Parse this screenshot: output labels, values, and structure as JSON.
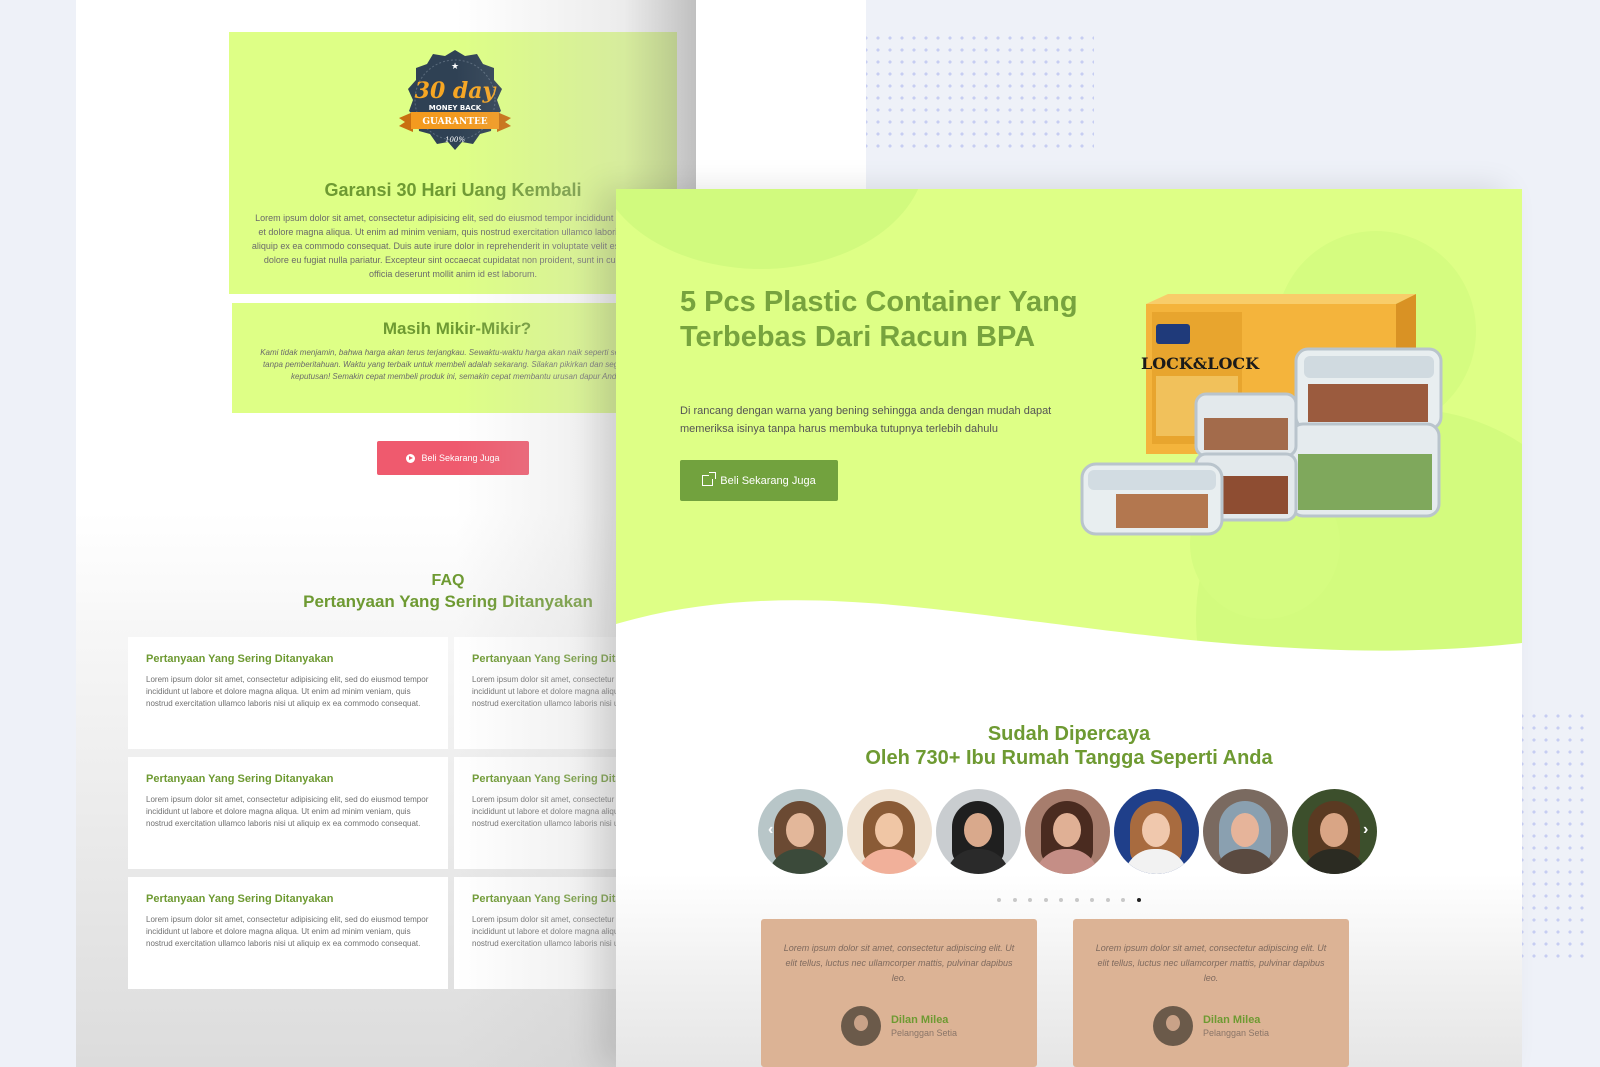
{
  "back_page": {
    "guarantee": {
      "badge": {
        "line1": "30 day",
        "line2": "MONEY BACK",
        "line3": "GUARANTEE",
        "line4": "100%"
      },
      "title": "Garansi 30 Hari Uang Kembali",
      "text": "Lorem ipsum dolor sit amet, consectetur adipisicing elit, sed do eiusmod tempor incididunt ut labore et dolore magna aliqua. Ut enim ad minim veniam, quis nostrud exercitation ullamco laboris nisi ut aliquip ex ea commodo consequat. Duis aute irure dolor in reprehenderit in voluptate velit esse cillum dolore eu fugiat nulla pariatur. Excepteur sint occaecat cupidatat non proident, sunt in culpa qui officia deserunt mollit anim id est laborum."
    },
    "hesitate": {
      "title": "Masih Mikir-Mikir?",
      "text": "Kami tidak menjamin, bahwa harga akan terus terjangkau. Sewaktu-waktu harga akan naik seperti sebelumnya tanpa pemberitahuan. Waktu yang terbaik untuk membeli adalah sekarang. Silakan pikirkan dan segera ambil keputusan! Semakin cepat membeli produk ini, semakin cepat membantu urusan dapur Anda."
    },
    "buy_button": "Beli Sekarang Juga",
    "faq": {
      "label": "FAQ",
      "subtitle": "Pertanyaan Yang Sering Ditanyakan",
      "items": [
        {
          "q": "Pertanyaan Yang Sering Ditanyakan",
          "a": "Lorem ipsum dolor sit amet, consectetur adipisicing elit, sed do eiusmod tempor incididunt ut labore et dolore magna aliqua. Ut enim ad minim veniam, quis nostrud exercitation ullamco laboris nisi ut aliquip ex ea commodo consequat."
        },
        {
          "q": "Pertanyaan Yang Sering Ditanyakan",
          "a": "Lorem ipsum dolor sit amet, consectetur adipisicing elit, sed do eiusmod tempor incididunt ut labore et dolore magna aliqua. Ut enim ad minim veniam, quis nostrud exercitation ullamco laboris nisi ut aliquip ex ea commodo consequat."
        },
        {
          "q": "Pertanyaan Yang Sering Ditanyakan",
          "a": "Lorem ipsum dolor sit amet, consectetur adipisicing elit, sed do eiusmod tempor incididunt ut labore et dolore magna aliqua. Ut enim ad minim veniam, quis nostrud exercitation ullamco laboris nisi ut aliquip ex ea commodo consequat."
        },
        {
          "q": "Pertanyaan Yang Sering Ditanyakan",
          "a": "Lorem ipsum dolor sit amet, consectetur adipisicing elit, sed do eiusmod tempor incididunt ut labore et dolore magna aliqua. Ut enim ad minim veniam, quis nostrud exercitation ullamco laboris nisi ut aliquip ex ea commodo consequat."
        },
        {
          "q": "Pertanyaan Yang Sering Ditanyakan",
          "a": "Lorem ipsum dolor sit amet, consectetur adipisicing elit, sed do eiusmod tempor incididunt ut labore et dolore magna aliqua. Ut enim ad minim veniam, quis nostrud exercitation ullamco laboris nisi ut aliquip ex ea commodo consequat."
        },
        {
          "q": "Pertanyaan Yang Sering Ditanyakan",
          "a": "Lorem ipsum dolor sit amet, consectetur adipisicing elit, sed do eiusmod tempor incididunt ut labore et dolore magna aliqua. Ut enim ad minim veniam, quis nostrud exercitation ullamco laboris nisi ut aliquip ex ea commodo consequat."
        }
      ]
    }
  },
  "front_page": {
    "hero": {
      "title": "5 Pcs Plastic Container Yang Terbebas Dari Racun BPA",
      "text": "Di rancang dengan warna yang bening sehingga anda dengan mudah dapat memeriksa isinya tanpa harus membuka tutupnya terlebih dahulu",
      "button": "Beli Sekarang Juga",
      "product_brand": "LOCK&LOCK"
    },
    "trust": {
      "line1": "Sudah Dipercaya",
      "line2": "Oleh 730+ Ibu Rumah Tangga Seperti Anda"
    },
    "carousel": {
      "prev_icon": "‹",
      "next_icon": "›",
      "avatar_count": 7,
      "dot_count": 10,
      "active_dot": 10
    },
    "testimonials": [
      {
        "text": "Lorem ipsum dolor sit amet, consectetur adipiscing elit. Ut elit tellus, luctus nec ullamcorper mattis, pulvinar dapibus leo.",
        "name": "Dilan Milea",
        "role": "Pelanggan Setia"
      },
      {
        "text": "Lorem ipsum dolor sit amet, consectetur adipiscing elit. Ut elit tellus, luctus nec ullamcorper mattis, pulvinar dapibus leo.",
        "name": "Dilan Milea",
        "role": "Pelanggan Setia"
      }
    ]
  },
  "colors": {
    "lime": "#deff86",
    "green_text": "#6e9a32",
    "green_button": "#72a23e",
    "red_button": "#ef5a6e",
    "testimonial_card": "#dcb395"
  }
}
